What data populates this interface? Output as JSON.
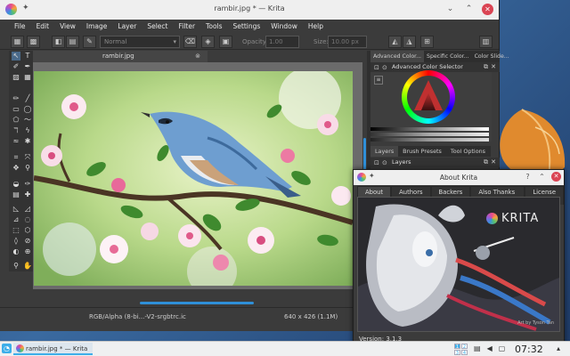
{
  "window": {
    "title": "rambir.jpg * — Krita"
  },
  "menubar": [
    "File",
    "Edit",
    "View",
    "Image",
    "Layer",
    "Select",
    "Filter",
    "Tools",
    "Settings",
    "Window",
    "Help"
  ],
  "toolbar": {
    "blend_mode": "Normal",
    "opacity_label": "Opacity:",
    "opacity_value": "1.00",
    "size_label": "Size:",
    "size_value": "10.00 px"
  },
  "document": {
    "tab_label": "rambir.jpg"
  },
  "status": {
    "colorspace": "RGB/Alpha (8-bi...-V2-srgbtrc.ic",
    "dimensions": "640 x 426 (1.1M)"
  },
  "dockers": {
    "top_tabs": [
      "Advanced Color...",
      "Specific Color...",
      "Color Slide..."
    ],
    "color_selector_title": "Advanced Color Selector",
    "bottom_tabs": [
      "Layers",
      "Brush Presets",
      "Tool Options"
    ],
    "layers_title": "Layers"
  },
  "about": {
    "title": "About Krita",
    "tabs": [
      "About",
      "Authors",
      "Backers",
      "Also Thanks To",
      "License"
    ],
    "logo_text": "KRITA",
    "credit": "Art by Tyson Tan",
    "version": "Version: 3.1.3"
  },
  "taskbar": {
    "task_label": "rambir.jpg * — Krita",
    "pager": [
      "1",
      "2",
      "3",
      "4"
    ],
    "clock": "07:32"
  },
  "colors": {
    "accent": "#3daee9",
    "close": "#da4453",
    "window_bg": "#3b3b3b"
  }
}
